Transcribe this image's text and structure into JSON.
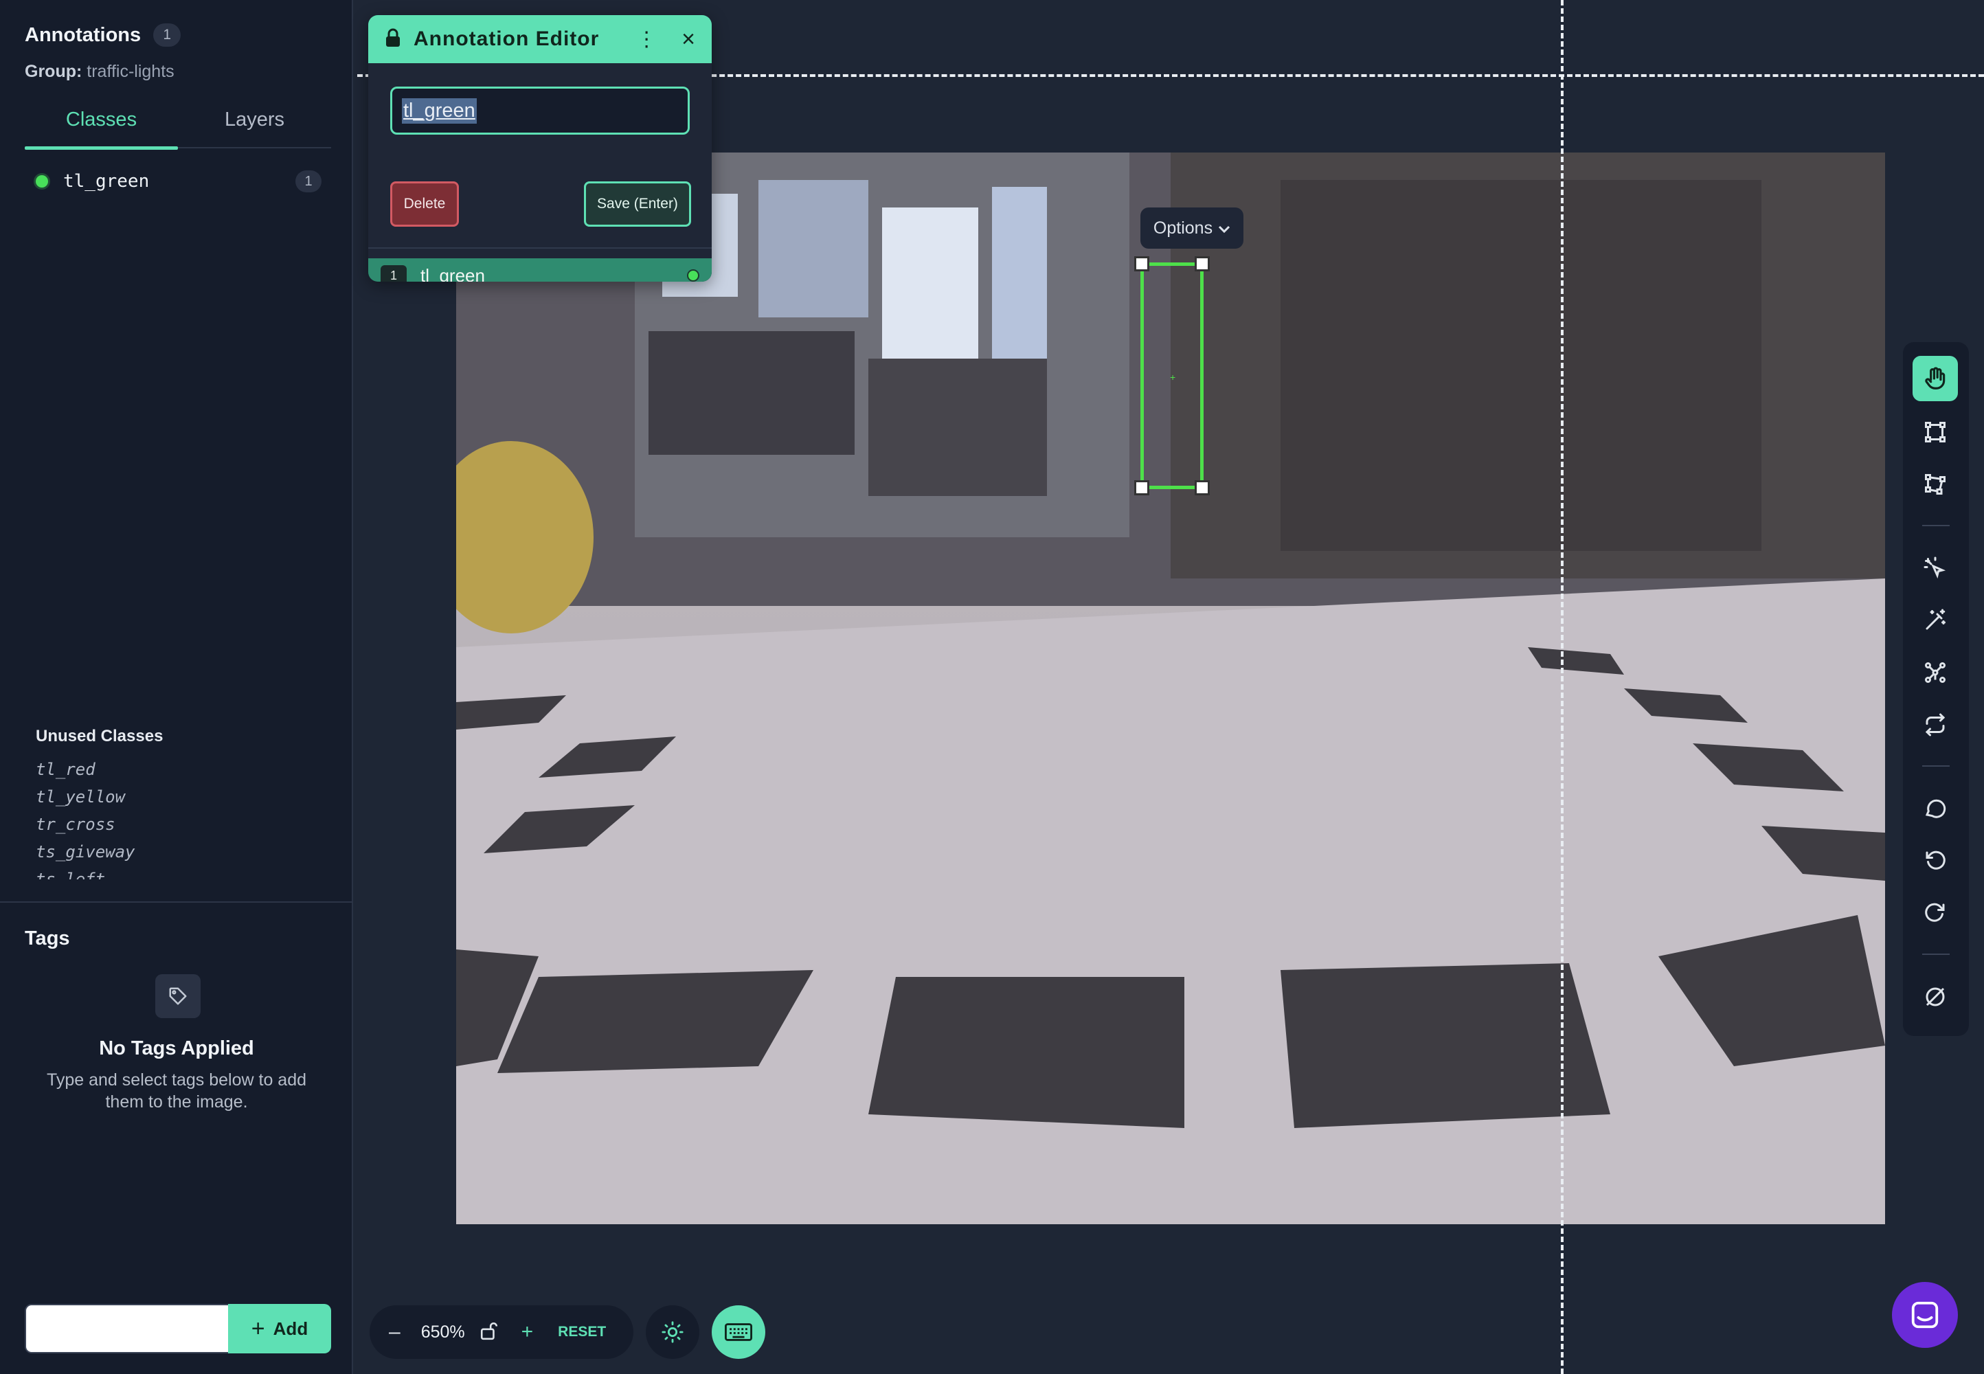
{
  "sidebar": {
    "title": "Annotations",
    "count": "1",
    "group_label": "Group:",
    "group_value": "traffic-lights",
    "tabs": [
      {
        "label": "Classes",
        "active": true
      },
      {
        "label": "Layers",
        "active": false
      }
    ],
    "classes": [
      {
        "name": "tl_green",
        "count": "1",
        "color": "#48e05a"
      }
    ],
    "unused_title": "Unused Classes",
    "unused_classes": [
      "tl_red",
      "tl_yellow",
      "tr_cross",
      "ts_giveway",
      "ts_left"
    ],
    "tags_title": "Tags",
    "tags_icon": "tag-icon",
    "no_tags_title": "No Tags Applied",
    "no_tags_sub": "Type and select tags below to add them to the image.",
    "tag_input_value": "",
    "add_label": "Add"
  },
  "editor": {
    "title": "Annotation Editor",
    "input_value": "tl_green",
    "delete_label": "Delete",
    "save_label": "Save (Enter)",
    "rows": [
      {
        "num": "1",
        "label": "tl_green"
      }
    ]
  },
  "canvas": {
    "options_label": "Options",
    "accent": "#5ee0b4",
    "bbox_color": "#4ee04a"
  },
  "zoom": {
    "minus": "–",
    "value": "650%",
    "plus": "+",
    "reset_label": "RESET"
  },
  "toolbar_icons": [
    "hand-icon",
    "bbox-tool-icon",
    "polygon-tool-icon",
    "smart-select-icon",
    "magic-wand-icon",
    "keypoint-icon",
    "repeat-icon",
    "comment-icon",
    "undo-icon",
    "redo-icon",
    "null-icon"
  ]
}
